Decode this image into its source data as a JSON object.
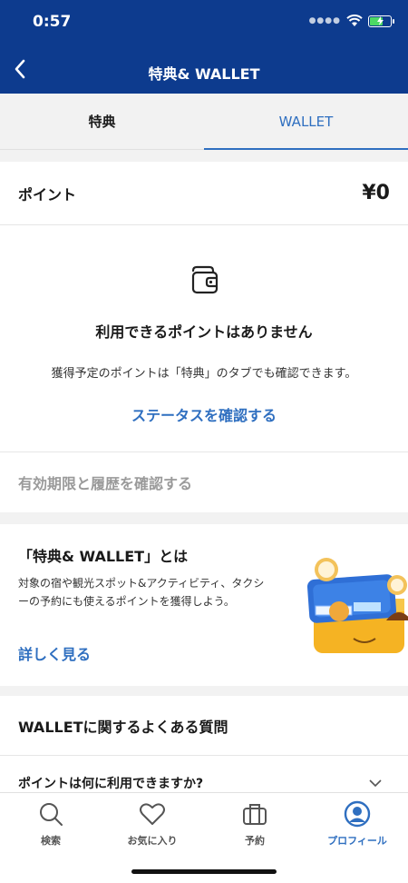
{
  "status_bar": {
    "time": "0:57"
  },
  "header": {
    "title": "特典& WALLET"
  },
  "tabs": [
    {
      "label": "特典",
      "active": false
    },
    {
      "label": "WALLET",
      "active": true
    }
  ],
  "points": {
    "label": "ポイント",
    "value": "¥0"
  },
  "empty_state": {
    "icon": "wallet-icon",
    "title": "利用できるポイントはありません",
    "description": "獲得予定のポイントは「特典」のタブでも確認できます。",
    "link": "ステータスを確認する"
  },
  "history_link": "有効期限と履歴を確認する",
  "about": {
    "title": "「特典& WALLET」とは",
    "description": "対象の宿や観光スポット&アクティビティ、タクシーの予約にも使えるポイントを獲得しよう。",
    "link": "詳しく見る"
  },
  "faq": {
    "heading": "WALLETに関するよくある質問",
    "items": [
      {
        "question": "ポイントは何に利用できますか?"
      }
    ]
  },
  "bottom_nav": [
    {
      "label": "検索",
      "icon": "search-icon",
      "active": false
    },
    {
      "label": "お気に入り",
      "icon": "heart-icon",
      "active": false
    },
    {
      "label": "予約",
      "icon": "suitcase-icon",
      "active": false
    },
    {
      "label": "プロフィール",
      "icon": "profile-icon",
      "active": true
    }
  ],
  "colors": {
    "brand": "#0d3b8e",
    "accent": "#2f6fc0",
    "muted": "#9a9a9a"
  }
}
